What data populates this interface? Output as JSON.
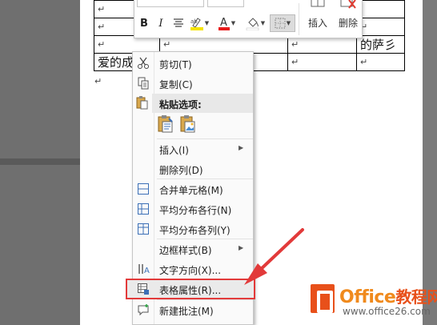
{
  "document": {
    "cells": {
      "r1c1": "↵",
      "r2c1": "↵",
      "r2c2": "↵",
      "r2c3": "↵",
      "r2c4": "↵",
      "r3c1": "↵",
      "r3c2": "↵",
      "r3c3": "↵",
      "r3c4": "的萨彡",
      "r4c1": "爱的成",
      "r4c2": "↵",
      "r4c3": "↵",
      "r4c4": "↵"
    },
    "paragraph_mark": "↵"
  },
  "mini_toolbar": {
    "bold": "B",
    "italic": "I",
    "font_color_glyph": "A",
    "highlight_color": "#f5e400",
    "font_color": "#e81a1a",
    "insert_label": "插入",
    "delete_label": "删除"
  },
  "context_menu": {
    "items": [
      {
        "label": "剪切(T)",
        "icon": "scissors-icon"
      },
      {
        "label": "复制(C)",
        "icon": "copy-icon"
      },
      {
        "label": "粘贴选项:",
        "icon": "paste-icon"
      },
      {
        "label": "插入(I)",
        "icon": ""
      },
      {
        "label": "删除列(D)",
        "icon": ""
      },
      {
        "label": "合并单元格(M)",
        "icon": "merge-cells-icon"
      },
      {
        "label": "平均分布各行(N)",
        "icon": "distribute-rows-icon"
      },
      {
        "label": "平均分布各列(Y)",
        "icon": "distribute-columns-icon"
      },
      {
        "label": "边框样式(B)",
        "icon": ""
      },
      {
        "label": "文字方向(X)...",
        "icon": "text-direction-icon"
      },
      {
        "label": "表格属性(R)...",
        "icon": "table-properties-icon"
      },
      {
        "label": "新建批注(M)",
        "icon": "new-comment-icon"
      }
    ]
  },
  "annotation_color": "#e23a3a",
  "logo": {
    "brand_latin": "Office",
    "brand_cn": "教程网",
    "url": "www.office26.com"
  }
}
